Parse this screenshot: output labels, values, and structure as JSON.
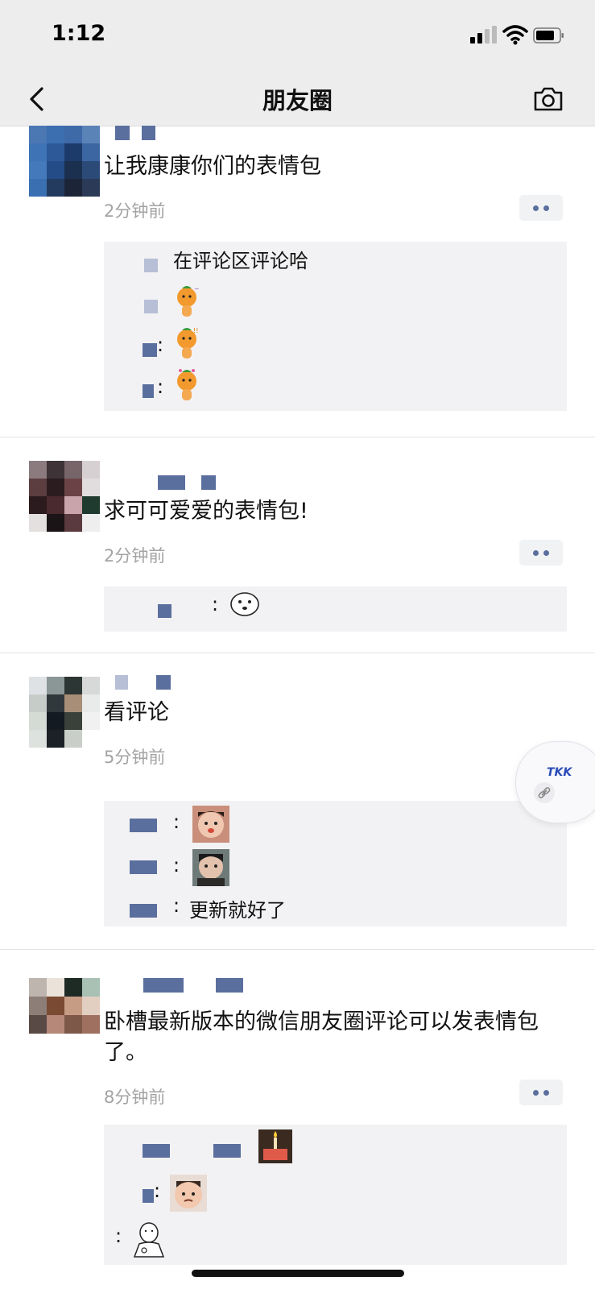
{
  "status_bar": {
    "time": "1:12"
  },
  "nav": {
    "title": "朋友圈"
  },
  "posts": [
    {
      "text": "让我康康你们的表情包",
      "time": "2分钟前",
      "comments": [
        {
          "colon": "",
          "text": "在评论区评论哈"
        },
        {
          "colon": "",
          "text": ""
        },
        {
          "colon": ":",
          "text": ""
        },
        {
          "colon": ":",
          "text": ""
        }
      ]
    },
    {
      "text": "求可可爱爱的表情包!",
      "time": "2分钟前",
      "comments": [
        {
          "colon": ":",
          "text": ""
        }
      ]
    },
    {
      "text": "看评论",
      "time": "5分钟前",
      "comments": [
        {
          "colon": ":",
          "text": ""
        },
        {
          "colon": ":",
          "text": ""
        },
        {
          "colon": ":",
          "text": "更新就好了"
        }
      ]
    },
    {
      "text": "卧槽最新版本的微信朋友圈评论可以发表情包了。",
      "time": "8分钟前",
      "comments": [
        {
          "colon": "",
          "text": ""
        },
        {
          "colon": ":",
          "text": ""
        },
        {
          "colon": ":",
          "text": ""
        }
      ]
    }
  ],
  "float_widget": {
    "label": "TKK"
  },
  "icons": {
    "back": "chevron-left-icon",
    "camera": "camera-icon",
    "more": "more-dots-icon",
    "signal": "signal-icon",
    "wifi": "wifi-icon",
    "battery": "battery-icon",
    "link": "link-icon"
  },
  "colors": {
    "nav_background": "#ededed",
    "name_blue": "#5b6f9e",
    "time_gray": "#a3a3a3",
    "comment_background": "#f2f2f4"
  }
}
